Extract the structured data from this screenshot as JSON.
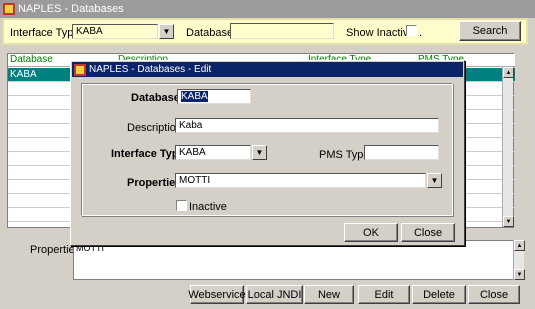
{
  "window": {
    "title": "NAPLES - Databases"
  },
  "filter": {
    "interface_type_label": "Interface Type",
    "interface_type_value": "KABA",
    "database_label": "Database",
    "database_value": "",
    "show_inactive_label": "Show Inactive",
    "show_inactive_suffix": ".",
    "search_label": "Search"
  },
  "grid": {
    "headers": [
      "Database",
      "Description",
      "Interface Type",
      "PMS Type"
    ],
    "rows": [
      {
        "database": "KABA",
        "selected": true
      }
    ]
  },
  "properties": {
    "label": "Properties",
    "value": "MOTTI"
  },
  "buttons": {
    "webservice": "Webservice",
    "local_jndi": "Local JNDI",
    "new": "New",
    "edit": "Edit",
    "delete": "Delete",
    "close": "Close"
  },
  "dialog": {
    "title": "NAPLES - Databases - Edit",
    "database_label": "Database",
    "database_value": "KABA",
    "description_label": "Description",
    "description_value": "Kaba",
    "interface_type_label": "Interface Type",
    "interface_type_value": "KABA",
    "pms_type_label": "PMS Type",
    "pms_type_value": "",
    "properties_label": "Properties",
    "properties_value": "MOTTI",
    "inactive_label": "Inactive",
    "ok_label": "OK",
    "close_label": "Close"
  },
  "colors": {
    "dialog_title_bg": "#0a246a",
    "selection": "#008080",
    "header_text": "#008000",
    "filter_bg": "#fffccc"
  }
}
